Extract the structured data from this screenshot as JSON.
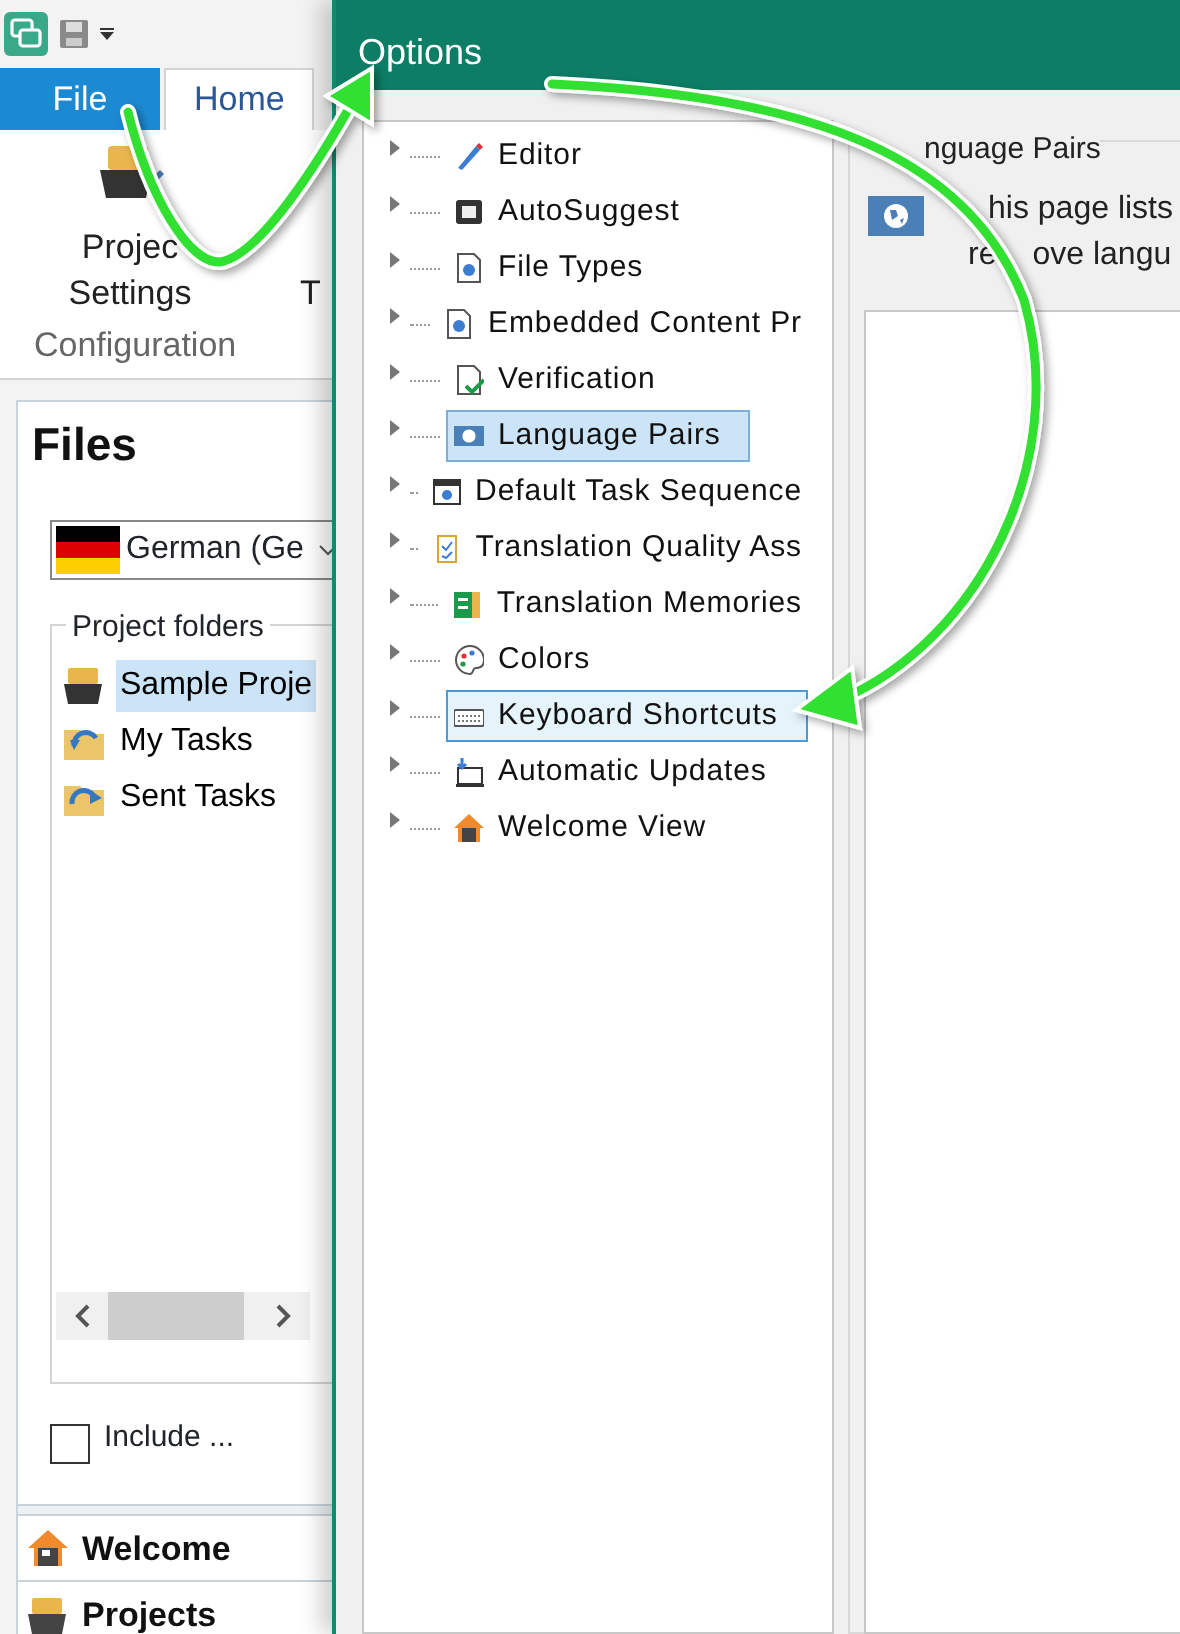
{
  "app": {
    "tabs": [
      {
        "label": "File",
        "kind": "backstage",
        "selected": false
      },
      {
        "label": "Home",
        "kind": "ribbon",
        "selected": true
      }
    ],
    "ribbon": {
      "buttons": [
        {
          "lines": [
            "Projec",
            "Settings"
          ]
        },
        {
          "lines": [
            "T"
          ]
        }
      ],
      "group_label": "Configuration"
    },
    "files": {
      "title": "Files",
      "language": "German (Ge",
      "folders_legend": "Project folders",
      "folders": [
        {
          "label": "Sample Proje",
          "selected": true
        },
        {
          "label": "My Tasks",
          "selected": false
        },
        {
          "label": "Sent Tasks",
          "selected": false
        }
      ],
      "include": {
        "label": "Include ...",
        "checked": false
      }
    },
    "nav": [
      "Welcome",
      "Projects"
    ]
  },
  "options": {
    "title": "Options",
    "tree": [
      {
        "label": "Editor",
        "selected": false,
        "hovered": false
      },
      {
        "label": "AutoSuggest",
        "selected": false,
        "hovered": false
      },
      {
        "label": "File Types",
        "selected": false,
        "hovered": false
      },
      {
        "label": "Embedded Content Pr",
        "selected": false,
        "hovered": false
      },
      {
        "label": "Verification",
        "selected": false,
        "hovered": false
      },
      {
        "label": "Language Pairs",
        "selected": true,
        "hovered": false
      },
      {
        "label": "Default Task Sequence",
        "selected": false,
        "hovered": false
      },
      {
        "label": "Translation Quality Ass",
        "selected": false,
        "hovered": false
      },
      {
        "label": "Translation Memories",
        "selected": false,
        "hovered": false
      },
      {
        "label": "Colors",
        "selected": false,
        "hovered": false
      },
      {
        "label": "Keyboard Shortcuts",
        "selected": false,
        "hovered": true
      },
      {
        "label": "Automatic Updates",
        "selected": false,
        "hovered": false
      },
      {
        "label": "Welcome View",
        "selected": false,
        "hovered": false
      }
    ],
    "page": {
      "group_title": "nguage Pairs",
      "description_lines": [
        [
          "his page lists"
        ],
        [
          "re",
          "ove langu"
        ]
      ]
    }
  }
}
